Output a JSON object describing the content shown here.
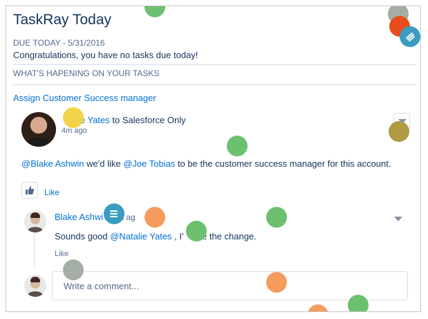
{
  "app": {
    "title": "TaskRay Today"
  },
  "due": {
    "label": "DUE TODAY - 5/31/2016",
    "message": "Congratulations, you have no tasks due today!"
  },
  "section": {
    "happening": "WHAT'S HAPENING ON YOUR TASKS"
  },
  "task": {
    "link": "Assign Customer Success manager"
  },
  "post": {
    "author_fragment": "ie Yates",
    "author_suffix": " to Salesforce Only",
    "time": "4m ago",
    "body_mention1": "@Blake Ashwin",
    "body_mid": " we'd like ",
    "body_mention2": "@Joe Tobias",
    "body_end": " to be the customer success manager for this account.",
    "like": "Like"
  },
  "reply": {
    "author": "Blake Ashwi",
    "time": "m ag",
    "body_prefix": "Sounds good ",
    "body_mention": "@Natalie Yates",
    "body_mid": " , I'",
    "body_end": "ke the change.",
    "like": "Like"
  },
  "comment": {
    "placeholder": "Write a comment..."
  },
  "icons": {
    "like": "thumbs-up-icon",
    "taskray": "taskray-logo-icon",
    "menu": "chevron-down-icon"
  },
  "colors": {
    "title": "#16325c",
    "link": "#0070d2",
    "muted": "#54698d",
    "dot_green": "#6cc070",
    "dot_orange": "#f59b5e",
    "dot_yellow": "#f3d34a",
    "dot_olive": "#b09a44",
    "dot_gray": "#a4aea4",
    "dot_red": "#e84c1c",
    "dot_blue": "#3a9cc0"
  }
}
